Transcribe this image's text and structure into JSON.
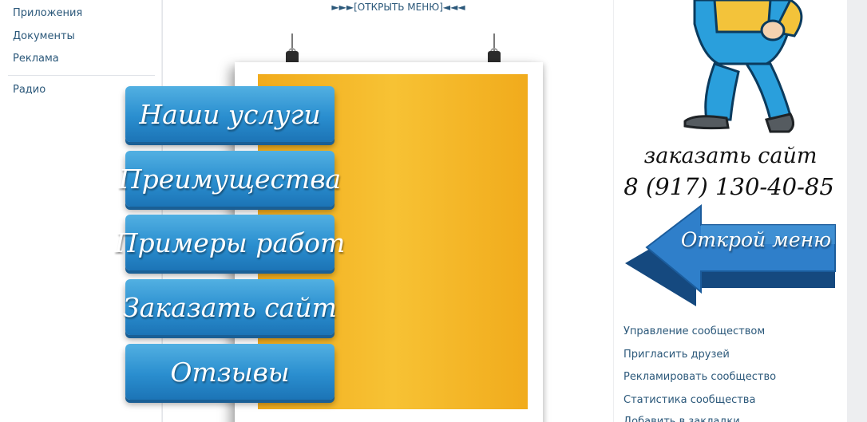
{
  "left_nav": {
    "items": [
      {
        "label": "Приложения"
      },
      {
        "label": "Документы"
      },
      {
        "label": "Реклама"
      },
      {
        "label": "Радио"
      }
    ]
  },
  "wiki": {
    "open_menu_link": "►►►[ОТКРЫТЬ МЕНЮ]◄◄◄",
    "menu_buttons": [
      {
        "label": "Наши услуги"
      },
      {
        "label": "Преимущества"
      },
      {
        "label": "Примеры работ"
      },
      {
        "label": "Заказать сайт"
      },
      {
        "label": "Отзывы"
      }
    ]
  },
  "banner": {
    "order_title": "заказать сайт",
    "phone": "8 (917) 130-40-85",
    "arrow_label": "Открой меню",
    "icon": "left-arrow-icon",
    "mascot": "worker-mascot"
  },
  "community_actions": [
    {
      "label": "Управление сообществом"
    },
    {
      "label": "Пригласить друзей"
    },
    {
      "label": "Рекламировать сообщество"
    },
    {
      "label": "Статистика сообщества"
    },
    {
      "label": "Добавить в закладки"
    }
  ],
  "colors": {
    "link": "#2b587a",
    "poster_background": "#f7c234",
    "button_blue": "#2a8ecf",
    "arrow_blue": "#1f6fb5"
  }
}
